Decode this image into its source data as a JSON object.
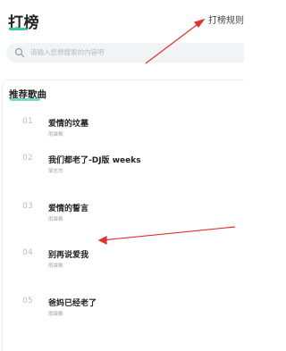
{
  "header": {
    "title": "打榜",
    "rules_link": "打榜规则"
  },
  "search": {
    "placeholder": "请输入您想搜索的内容吧",
    "icon": "search-icon"
  },
  "recommend": {
    "title": "推荐歌曲",
    "songs": [
      {
        "index": "01",
        "name": "爱情的坟墓",
        "artist": "雨霖枫"
      },
      {
        "index": "02",
        "name": "我们都老了-DJ版 weeks",
        "artist": "邹志杰"
      },
      {
        "index": "03",
        "name": "爱情的誓言",
        "artist": "雨霖枫"
      },
      {
        "index": "04",
        "name": "别再说爱我",
        "artist": "雨霖枫"
      },
      {
        "index": "05",
        "name": "爸妈已经老了",
        "artist": "雨霖枫"
      }
    ]
  },
  "colors": {
    "accent": "#3ec6a8",
    "annotation_arrow": "#e0322b"
  }
}
